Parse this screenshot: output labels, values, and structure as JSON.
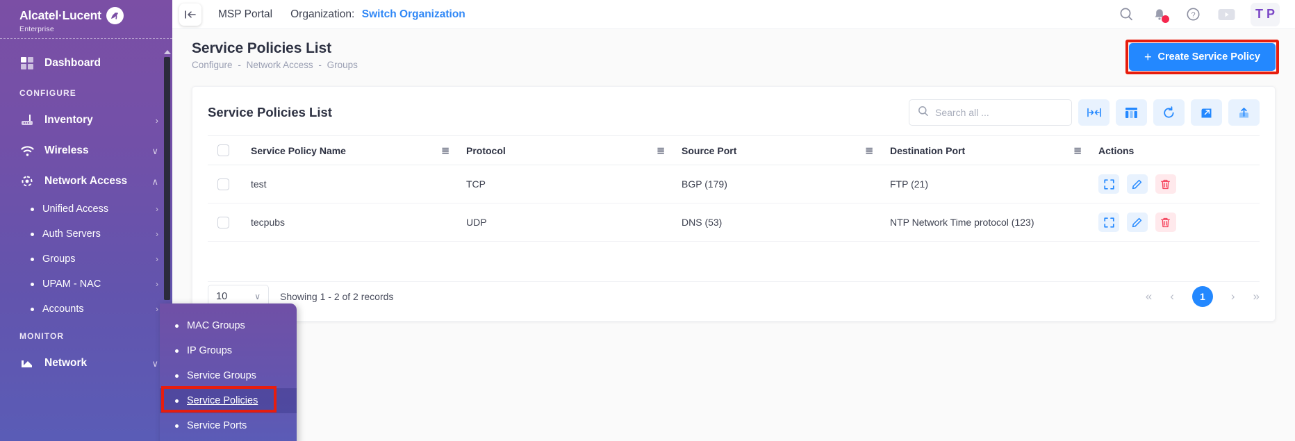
{
  "brand": {
    "name": "Alcatel·Lucent",
    "sub": "Enterprise",
    "logo_icon": "alcatel-lucent-logo-icon"
  },
  "sidebar": {
    "collapse_icon": "collapse-sidebar-icon",
    "groups": [
      {
        "type": "item",
        "label": "Dashboard",
        "icon": "dashboard-grid-icon",
        "caret": ""
      },
      {
        "type": "section",
        "label": "CONFIGURE"
      },
      {
        "type": "item",
        "label": "Inventory",
        "icon": "inventory-device-icon",
        "caret": "›"
      },
      {
        "type": "item",
        "label": "Wireless",
        "icon": "wifi-icon",
        "caret": "∨"
      },
      {
        "type": "item",
        "label": "Network Access",
        "icon": "network-access-icon",
        "caret": "∧"
      },
      {
        "type": "sub",
        "label": "Unified Access",
        "caret": "›"
      },
      {
        "type": "sub",
        "label": "Auth Servers",
        "caret": "›"
      },
      {
        "type": "sub",
        "label": "Groups",
        "caret": "›"
      },
      {
        "type": "sub",
        "label": "UPAM - NAC",
        "caret": "›"
      },
      {
        "type": "sub",
        "label": "Accounts",
        "caret": "›"
      },
      {
        "type": "section",
        "label": "MONITOR"
      },
      {
        "type": "item",
        "label": "Network",
        "icon": "network-chart-icon",
        "caret": "∨"
      }
    ]
  },
  "flyout": {
    "items": [
      {
        "label": "MAC Groups",
        "active": false
      },
      {
        "label": "IP Groups",
        "active": false
      },
      {
        "label": "Service Groups",
        "active": false
      },
      {
        "label": "Service Policies",
        "active": true
      },
      {
        "label": "Service Ports",
        "active": false
      }
    ]
  },
  "topbar": {
    "portal": "MSP Portal",
    "org_label": "Organization:",
    "org_link": "Switch Organization",
    "icons": [
      {
        "name": "search-icon"
      },
      {
        "name": "notification-bell-icon",
        "badge": true
      },
      {
        "name": "help-circle-icon"
      },
      {
        "name": "video-play-icon"
      }
    ],
    "avatar_initials": "T P"
  },
  "page": {
    "title": "Service Policies List",
    "breadcrumb": [
      "Configure",
      "Network Access",
      "Groups"
    ],
    "breadcrumb_sep": "-",
    "create_button": "Create Service Policy",
    "create_plus": "+"
  },
  "card": {
    "title": "Service Policies List",
    "search_placeholder": "Search all ...",
    "search_value": "",
    "search_icon": "search-icon",
    "tools": [
      {
        "name": "fit-columns-icon"
      },
      {
        "name": "column-settings-icon"
      },
      {
        "name": "refresh-icon"
      },
      {
        "name": "expand-icon"
      },
      {
        "name": "export-upload-icon"
      }
    ]
  },
  "table": {
    "columns": [
      {
        "label": "Service Policy Name",
        "menu_icon": "column-menu-icon"
      },
      {
        "label": "Protocol",
        "menu_icon": "column-menu-icon"
      },
      {
        "label": "Source Port",
        "menu_icon": "column-menu-icon"
      },
      {
        "label": "Destination Port",
        "menu_icon": "column-menu-icon"
      },
      {
        "label": "Actions",
        "menu_icon": ""
      }
    ],
    "rows": [
      {
        "name": "test",
        "protocol": "TCP",
        "source_port": "BGP (179)",
        "destination_port": "FTP (21)"
      },
      {
        "name": "tecpubs",
        "protocol": "UDP",
        "source_port": "DNS (53)",
        "destination_port": "NTP Network Time protocol (123)"
      }
    ],
    "row_actions": [
      {
        "name": "view-detail-icon"
      },
      {
        "name": "edit-icon"
      },
      {
        "name": "delete-icon"
      }
    ]
  },
  "footer": {
    "page_size": "10",
    "page_size_caret": "∨",
    "showing": "Showing 1 - 2 of 2 records",
    "pager": {
      "first": "«",
      "prev": "‹",
      "current": "1",
      "next": "›",
      "last": "»"
    }
  },
  "colors": {
    "brand_purple": "#7b4fa5",
    "accent_blue": "#2388ff",
    "highlight_red": "#e71d0e",
    "danger": "#f5475f"
  }
}
